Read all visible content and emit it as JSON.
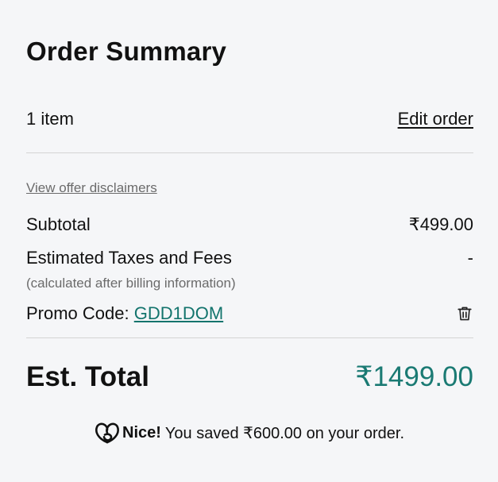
{
  "summary": {
    "title": "Order Summary",
    "item_count": "1 item",
    "edit_order_label": "Edit order",
    "disclaimers_link": "View offer disclaimers",
    "subtotal_label": "Subtotal",
    "subtotal_value": "₹499.00",
    "taxes_label": "Estimated Taxes and Fees",
    "taxes_value": "-",
    "taxes_note": "(calculated after billing information)",
    "promo_label": "Promo Code: ",
    "promo_code": "GDD1DOM",
    "total_label": "Est. Total",
    "total_value": "₹1499.00",
    "savings_strong": "Nice!",
    "savings_text": "You saved ₹600.00 on your order."
  },
  "colors": {
    "background": "#f5f6f8",
    "accent": "#1a7a73",
    "muted": "#6b6b6b",
    "divider": "#d4d4d4"
  },
  "icons": {
    "remove_promo": "trash-icon",
    "brand": "godaddy-logo-icon"
  }
}
